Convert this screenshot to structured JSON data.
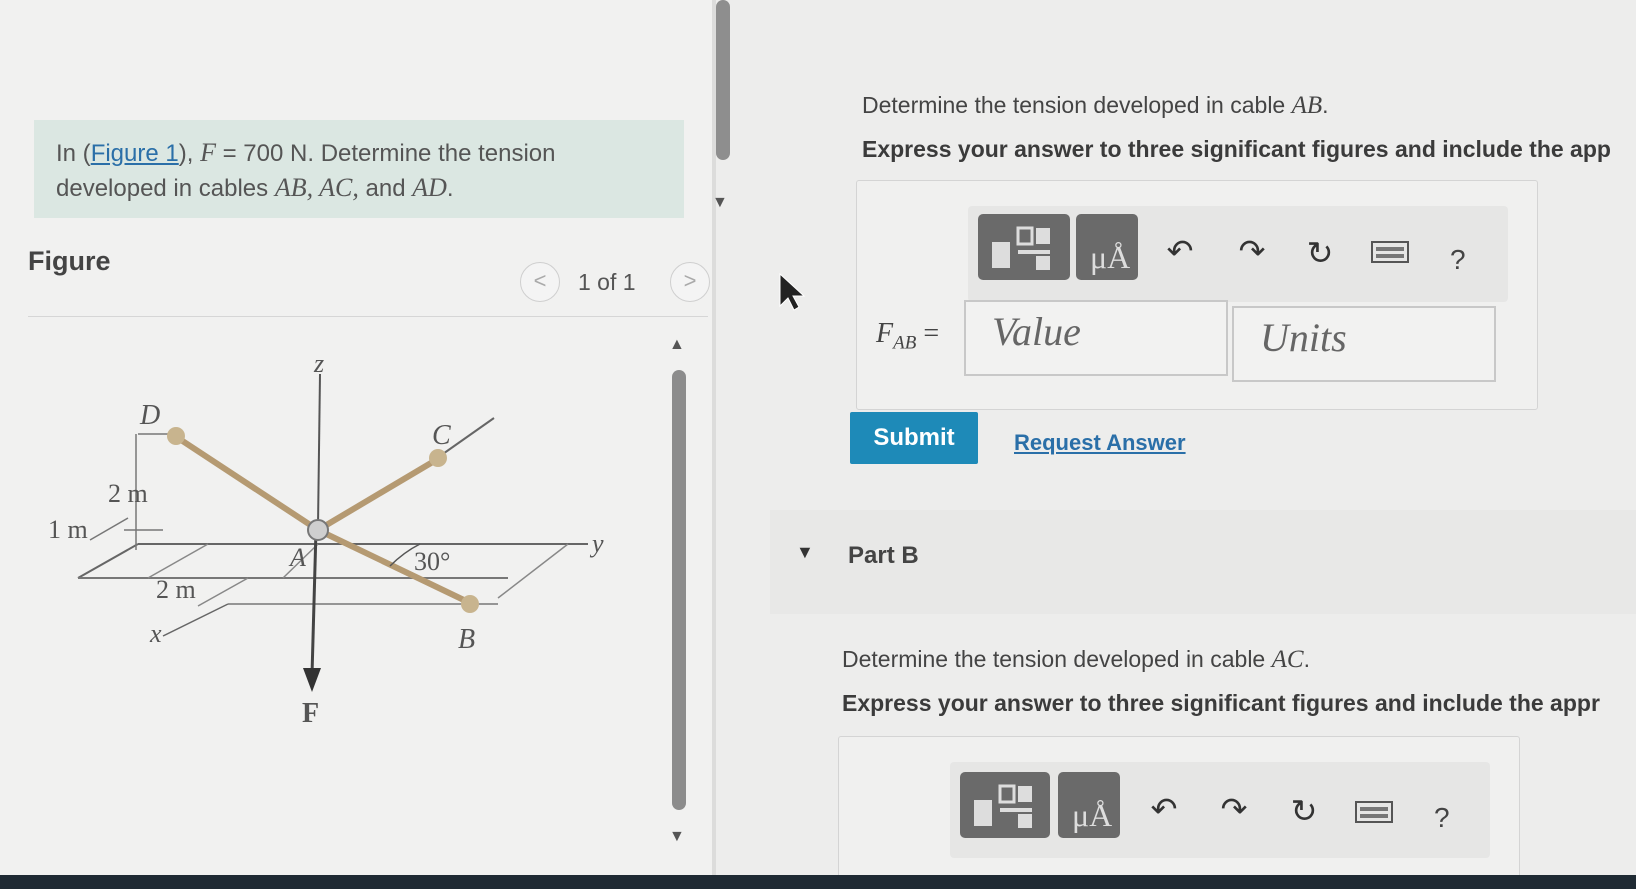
{
  "problem": {
    "intro": "In (",
    "figure_link": "Figure 1",
    "after_link": "), ",
    "force_symbol": "F",
    "force_value": " = 700 N",
    "text1": ". Determine the tension",
    "text2": "developed in cables ",
    "cables": "AB, AC,",
    "and": " and ",
    "cable_last": "AD",
    "period": "."
  },
  "figure": {
    "title": "Figure",
    "pager_text": "1 of 1",
    "prev_glyph": "<",
    "next_glyph": ">",
    "labels": {
      "z": "z",
      "y": "y",
      "x": "x",
      "D": "D",
      "C": "C",
      "A": "A",
      "B": "B",
      "F": "F",
      "dim_2m_vertical": "2 m",
      "dim_1m": "1 m",
      "dim_2m_x": "2 m",
      "angle": "30°"
    }
  },
  "part_a": {
    "question_prefix": "Determine the tension developed in cable ",
    "cable": "AB",
    "question_suffix": ".",
    "instruction": "Express your answer to three significant figures and include the app",
    "label_symbol": "F",
    "label_sub": "AB",
    "label_eq": " =",
    "value_placeholder": "Value",
    "units_placeholder": "Units",
    "submit": "Submit",
    "request": "Request Answer",
    "help": "?"
  },
  "part_b": {
    "label": "Part B",
    "question_prefix": "Determine the tension developed in cable ",
    "cable": "AC",
    "question_suffix": ".",
    "instruction": "Express your answer to three significant figures and include the appr",
    "help": "?"
  },
  "colors": {
    "accent": "#1e8ab8",
    "link": "#2a6fa8",
    "problem_bg": "#dbe7e2",
    "cable": "#b59a72"
  }
}
